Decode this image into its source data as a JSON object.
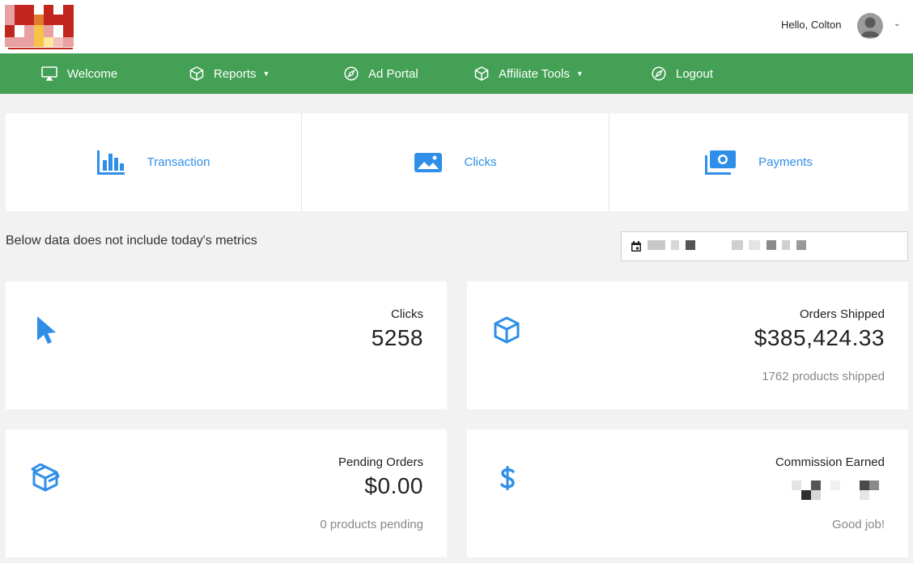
{
  "header": {
    "greeting": "Hello, Colton",
    "avatar_caret": "⌄"
  },
  "nav": {
    "items": [
      {
        "label": "Welcome",
        "icon": "monitor-icon"
      },
      {
        "label": "Reports",
        "icon": "cube-icon",
        "dropdown": true
      },
      {
        "label": "Ad Portal",
        "icon": "compass-icon"
      },
      {
        "label": "Affiliate Tools",
        "icon": "cube-icon",
        "dropdown": true
      },
      {
        "label": "Logout",
        "icon": "compass-icon"
      }
    ],
    "caret": "▼"
  },
  "quicklinks": [
    {
      "label": "Transaction",
      "icon": "bar-chart-icon"
    },
    {
      "label": "Clicks",
      "icon": "image-icon"
    },
    {
      "label": "Payments",
      "icon": "money-icon"
    }
  ],
  "note": "Below data does not include today's metrics",
  "cards": {
    "clicks": {
      "title": "Clicks",
      "value": "5258",
      "icon": "cursor-icon"
    },
    "orders_shipped": {
      "title": "Orders Shipped",
      "value": "$385,424.33",
      "sub": "1762 products shipped",
      "icon": "cube-icon"
    },
    "pending_orders": {
      "title": "Pending Orders",
      "value": "$0.00",
      "sub": "0 products pending",
      "icon": "open-box-icon"
    },
    "commission": {
      "title": "Commission Earned",
      "sub": "Good job!",
      "icon": "dollar-icon"
    }
  },
  "colors": {
    "nav_bg": "#43a055",
    "accent_blue": "#2f8fe8",
    "page_bg": "#f2f2f2"
  }
}
